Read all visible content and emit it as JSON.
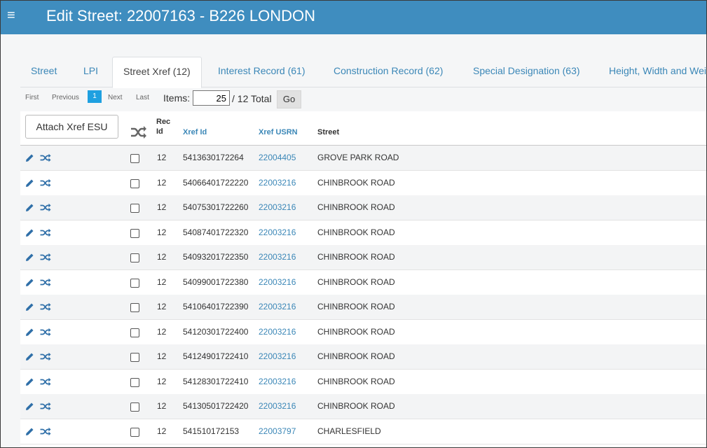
{
  "header": {
    "menu_glyph": "≡",
    "title": "Edit Street: 22007163 - B226 LONDON"
  },
  "tabs": [
    {
      "label": "Street"
    },
    {
      "label": "LPI"
    },
    {
      "label": "Street Xref (12)",
      "active": true
    },
    {
      "label": "Interest Record (61)"
    },
    {
      "label": "Construction Record (62)"
    },
    {
      "label": "Special Designation (63)"
    },
    {
      "label": "Height, Width and Weight"
    }
  ],
  "pager": {
    "first": "First",
    "previous": "Previous",
    "current_page": "1",
    "next": "Next",
    "last": "Last",
    "items_label": "Items:",
    "items_value": "25",
    "total": "/ 12 Total",
    "go": "Go"
  },
  "table": {
    "attach_button": "Attach Xref ESU",
    "columns": {
      "rec_id": "Rec\nId",
      "xref_id": "Xref Id",
      "xref_usrn": "Xref USRN",
      "street": "Street"
    },
    "rows": [
      {
        "rec_id": "12",
        "xref_id": "5413630172264",
        "xref_usrn": "22004405",
        "street": "GROVE PARK ROAD"
      },
      {
        "rec_id": "12",
        "xref_id": "54066401722220",
        "xref_usrn": "22003216",
        "street": "CHINBROOK ROAD"
      },
      {
        "rec_id": "12",
        "xref_id": "54075301722260",
        "xref_usrn": "22003216",
        "street": "CHINBROOK ROAD"
      },
      {
        "rec_id": "12",
        "xref_id": "54087401722320",
        "xref_usrn": "22003216",
        "street": "CHINBROOK ROAD"
      },
      {
        "rec_id": "12",
        "xref_id": "54093201722350",
        "xref_usrn": "22003216",
        "street": "CHINBROOK ROAD"
      },
      {
        "rec_id": "12",
        "xref_id": "54099001722380",
        "xref_usrn": "22003216",
        "street": "CHINBROOK ROAD"
      },
      {
        "rec_id": "12",
        "xref_id": "54106401722390",
        "xref_usrn": "22003216",
        "street": "CHINBROOK ROAD"
      },
      {
        "rec_id": "12",
        "xref_id": "54120301722400",
        "xref_usrn": "22003216",
        "street": "CHINBROOK ROAD"
      },
      {
        "rec_id": "12",
        "xref_id": "54124901722410",
        "xref_usrn": "22003216",
        "street": "CHINBROOK ROAD"
      },
      {
        "rec_id": "12",
        "xref_id": "54128301722410",
        "xref_usrn": "22003216",
        "street": "CHINBROOK ROAD"
      },
      {
        "rec_id": "12",
        "xref_id": "54130501722420",
        "xref_usrn": "22003216",
        "street": "CHINBROOK ROAD"
      },
      {
        "rec_id": "12",
        "xref_id": "541510172153",
        "xref_usrn": "22003797",
        "street": "CHARLESFIELD"
      }
    ]
  },
  "colors": {
    "header_bg": "#3f8dbf",
    "link": "#3b87b7",
    "page_active": "#1fa0e0",
    "icon": "#2f6fa8"
  }
}
